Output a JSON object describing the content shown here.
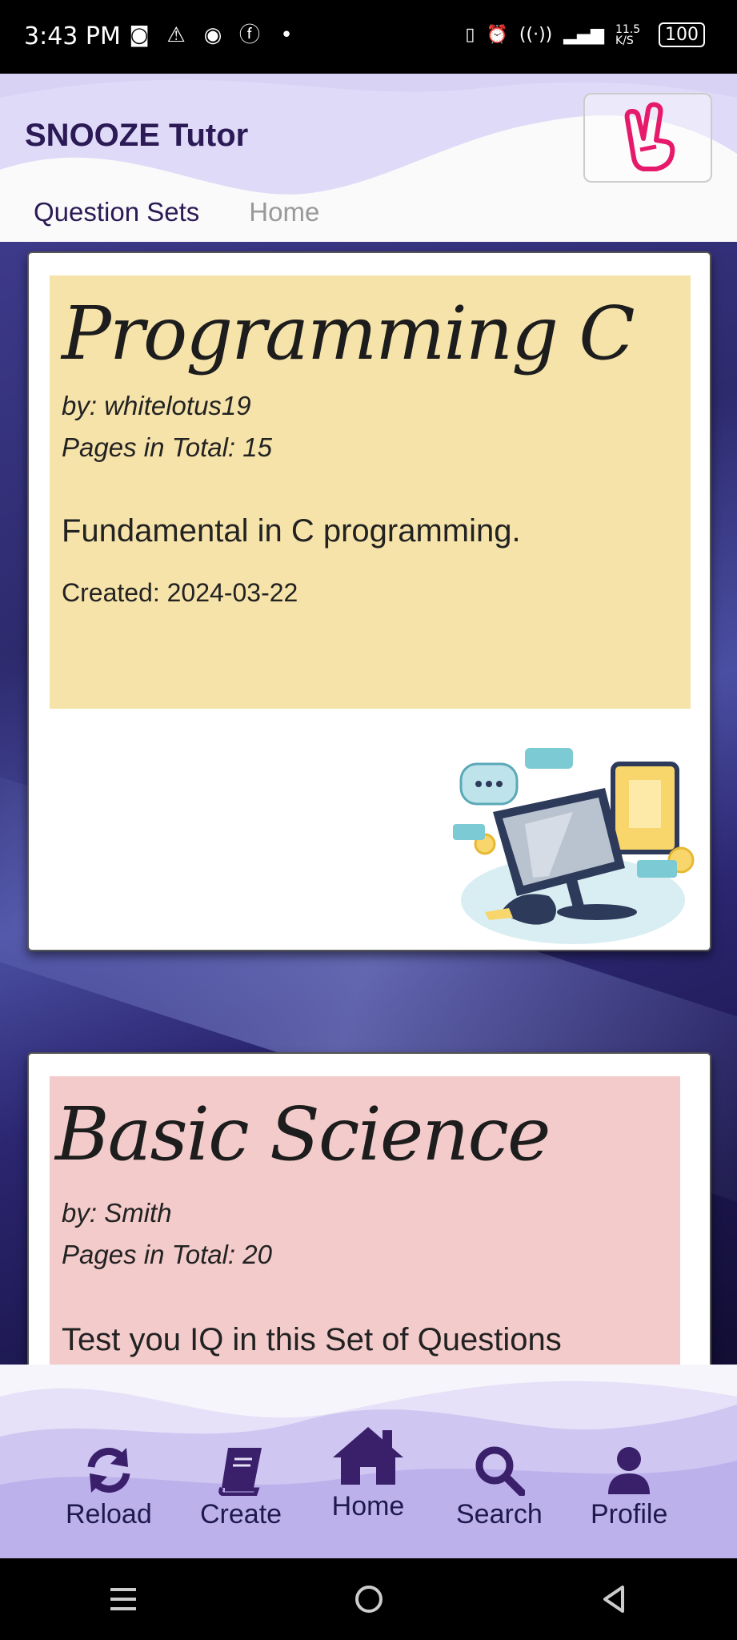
{
  "status_bar": {
    "time": "3:43 PM",
    "network_speed": "11.5 K/S",
    "battery": "100"
  },
  "header": {
    "app_title": "SNOOZE Tutor",
    "tabs": [
      {
        "label": "Question Sets"
      },
      {
        "label": "Home"
      }
    ]
  },
  "cards": [
    {
      "title": "Programming C",
      "author": "by: whitelotus19",
      "pages": "Pages in Total: 15",
      "description": "Fundamental in C programming.",
      "created": "Created: 2024-03-22",
      "color": "#f6e3aa"
    },
    {
      "title": "Basic Science",
      "author": "by: Smith",
      "pages": "Pages in Total: 20",
      "description": "Test you IQ in this Set of Questions",
      "color": "#f4cbcb"
    }
  ],
  "bottom_nav": [
    {
      "label": "Reload",
      "icon": "reload-icon"
    },
    {
      "label": "Create",
      "icon": "book-icon"
    },
    {
      "label": "Home",
      "icon": "home-icon"
    },
    {
      "label": "Search",
      "icon": "search-icon"
    },
    {
      "label": "Profile",
      "icon": "profile-icon"
    }
  ],
  "colors": {
    "primary": "#2b1a55",
    "accent_wave": "#c8bff0",
    "card1": "#f6e3aa",
    "card2": "#f4cbcb"
  }
}
